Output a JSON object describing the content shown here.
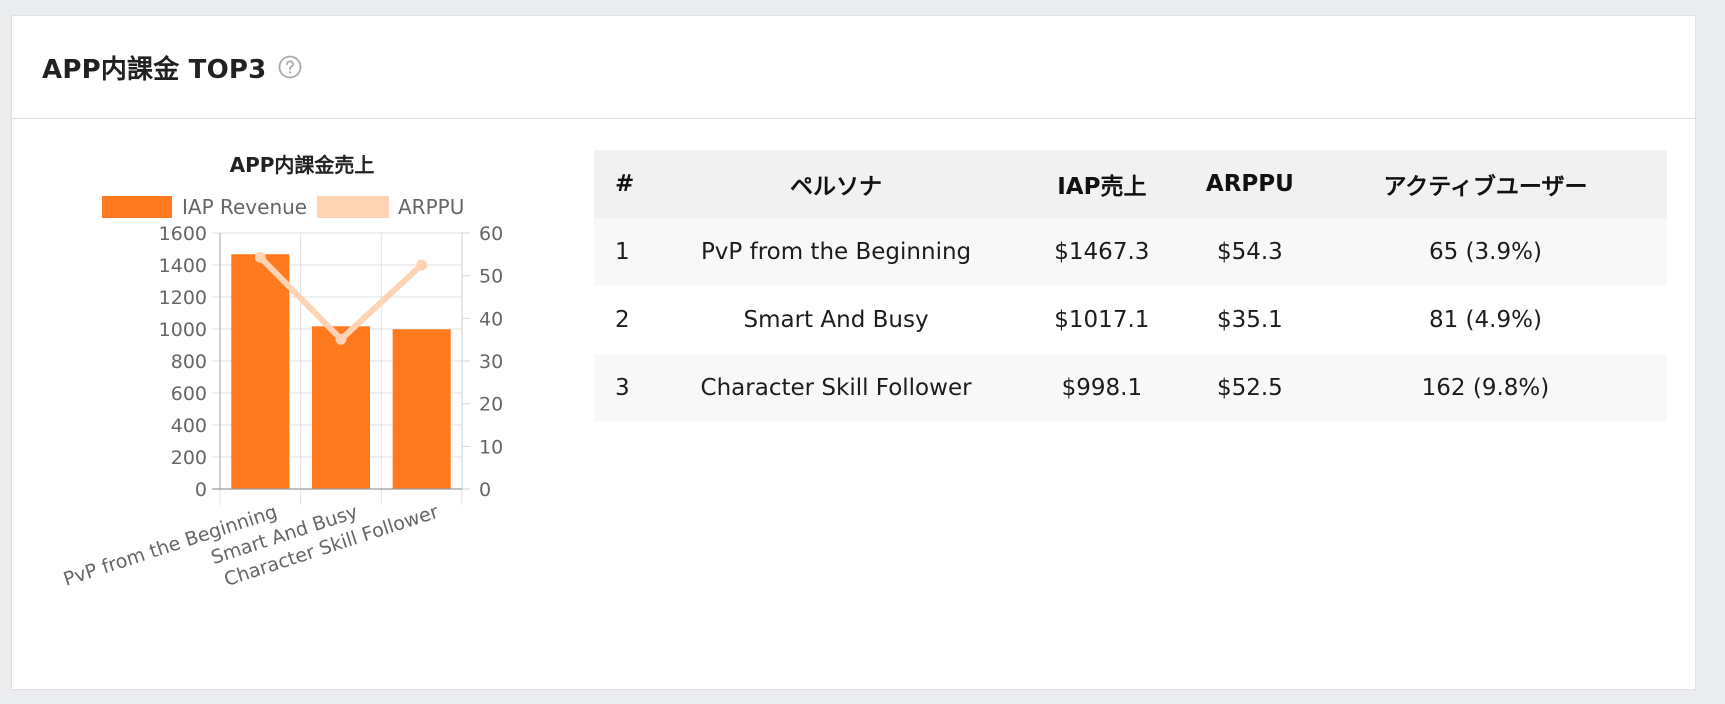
{
  "card": {
    "title": "APP内課金 TOP3",
    "help_icon": "question-circle-icon"
  },
  "chart_data": {
    "type": "bar",
    "title": "APP内課金売上",
    "categories": [
      "PvP from the Beginning",
      "Smart And Busy",
      "Character Skill Follower"
    ],
    "series": [
      {
        "name": "IAP Revenue",
        "type": "bar",
        "axis": "left",
        "color": "#ff7a1f",
        "values": [
          1467.3,
          1017.1,
          998.1
        ]
      },
      {
        "name": "ARPPU",
        "type": "line",
        "axis": "right",
        "color": "#ffd4b5",
        "values": [
          54.3,
          35.1,
          52.5
        ]
      }
    ],
    "y_left": {
      "min": 0,
      "max": 1600,
      "ticks": [
        0,
        200,
        400,
        600,
        800,
        1000,
        1200,
        1400,
        1600
      ]
    },
    "y_right": {
      "min": 0,
      "max": 60,
      "ticks": [
        0,
        10,
        20,
        30,
        40,
        50,
        60
      ]
    },
    "xlabel": "",
    "ylabel": "",
    "grid": true,
    "legend_position": "top"
  },
  "table": {
    "headers": [
      "#",
      "ペルソナ",
      "IAP売上",
      "ARPPU",
      "アクティブユーザー"
    ],
    "rows": [
      [
        "1",
        "PvP from the Beginning",
        "$1467.3",
        "$54.3",
        "65 (3.9%)"
      ],
      [
        "2",
        "Smart And Busy",
        "$1017.1",
        "$35.1",
        "81 (4.9%)"
      ],
      [
        "3",
        "Character Skill Follower",
        "$998.1",
        "$52.5",
        "162 (9.8%)"
      ]
    ]
  }
}
